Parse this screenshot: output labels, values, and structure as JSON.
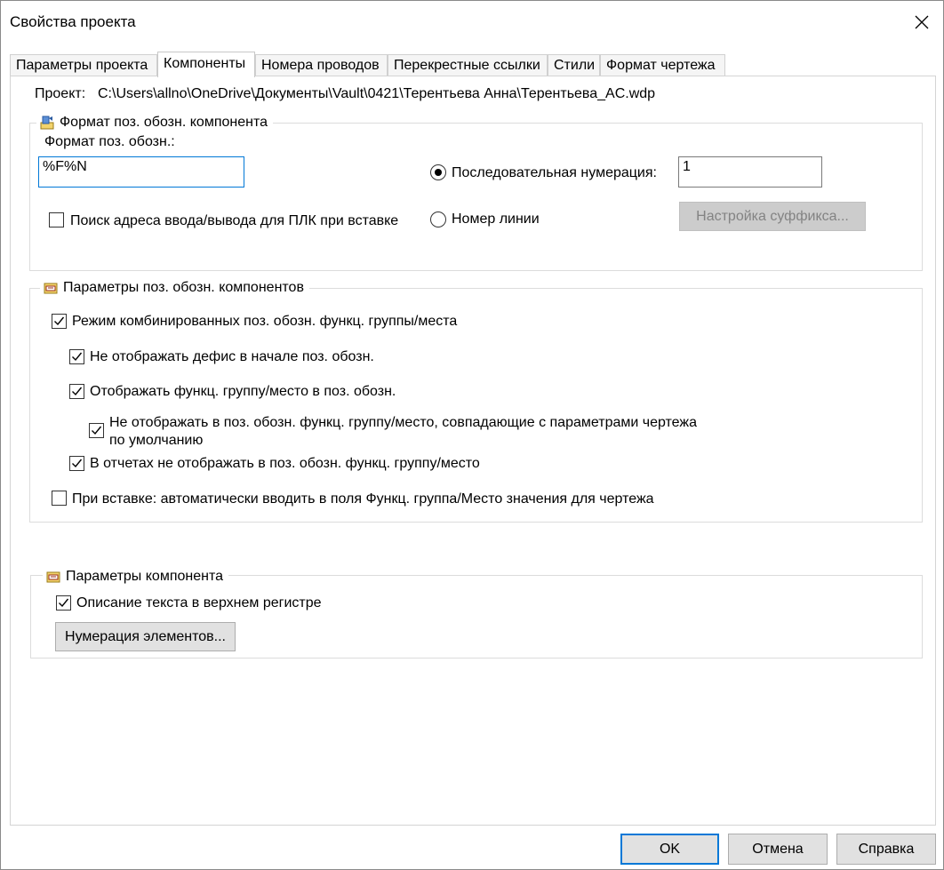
{
  "window": {
    "title": "Свойства проекта"
  },
  "tabs": [
    {
      "label": "Параметры проекта"
    },
    {
      "label": "Компоненты"
    },
    {
      "label": "Номера проводов"
    },
    {
      "label": "Перекрестные ссылки"
    },
    {
      "label": "Стили"
    },
    {
      "label": "Формат чертежа"
    }
  ],
  "active_tab": "Компоненты",
  "project": {
    "label": "Проект:",
    "path": "C:\\Users\\allno\\OneDrive\\Документы\\Vault\\0421\\Терентьева Анна\\Терентьева_AC.wdp"
  },
  "tag_format": {
    "group_title": "Формат поз. обозн. компонента",
    "format_label": "Формат поз. обозн.:",
    "format_value": "%F%N",
    "sequential_label": "Последовательная нумерация:",
    "sequential_value": "1",
    "sequential_selected": true,
    "line_number_label": "Номер линии",
    "line_number_selected": false,
    "plc_search_label": "Поиск адреса ввода/вывода для ПЛК при вставке",
    "plc_search_checked": false,
    "suffix_button": "Настройка суффикса..."
  },
  "tag_options": {
    "group_title": "Параметры поз. обозн. компонентов",
    "combined_mode_label": "Режим комбинированных поз. обозн. функц. группы/места",
    "combined_mode_checked": true,
    "no_hyphen_label": "Не отображать дефис в начале поз. обозн.",
    "no_hyphen_checked": true,
    "show_group_label": "Отображать функц. группу/место в поз. обозн.",
    "show_group_checked": true,
    "hide_default_label_1": "Не отображать в поз. обозн. функц. группу/место, совпадающие с параметрами чертежа",
    "hide_default_label_2": "по умолчанию",
    "hide_default_checked": true,
    "reports_label": "В отчетах не отображать в поз. обозн. функц. группу/место",
    "reports_checked": true,
    "auto_fill_label": "При вставке: автоматически вводить в поля Функц. группа/Место значения для чертежа",
    "auto_fill_checked": false
  },
  "component_options": {
    "group_title": "Параметры компонента",
    "uppercase_label": "Описание текста в верхнем регистре",
    "uppercase_checked": true,
    "numbering_button": "Нумерация элементов..."
  },
  "footer": {
    "ok": "OK",
    "cancel": "Отмена",
    "help": "Справка"
  },
  "colors": {
    "accent": "#0078d7",
    "disabled_button": "#cccccc",
    "button": "#e1e1e1"
  }
}
